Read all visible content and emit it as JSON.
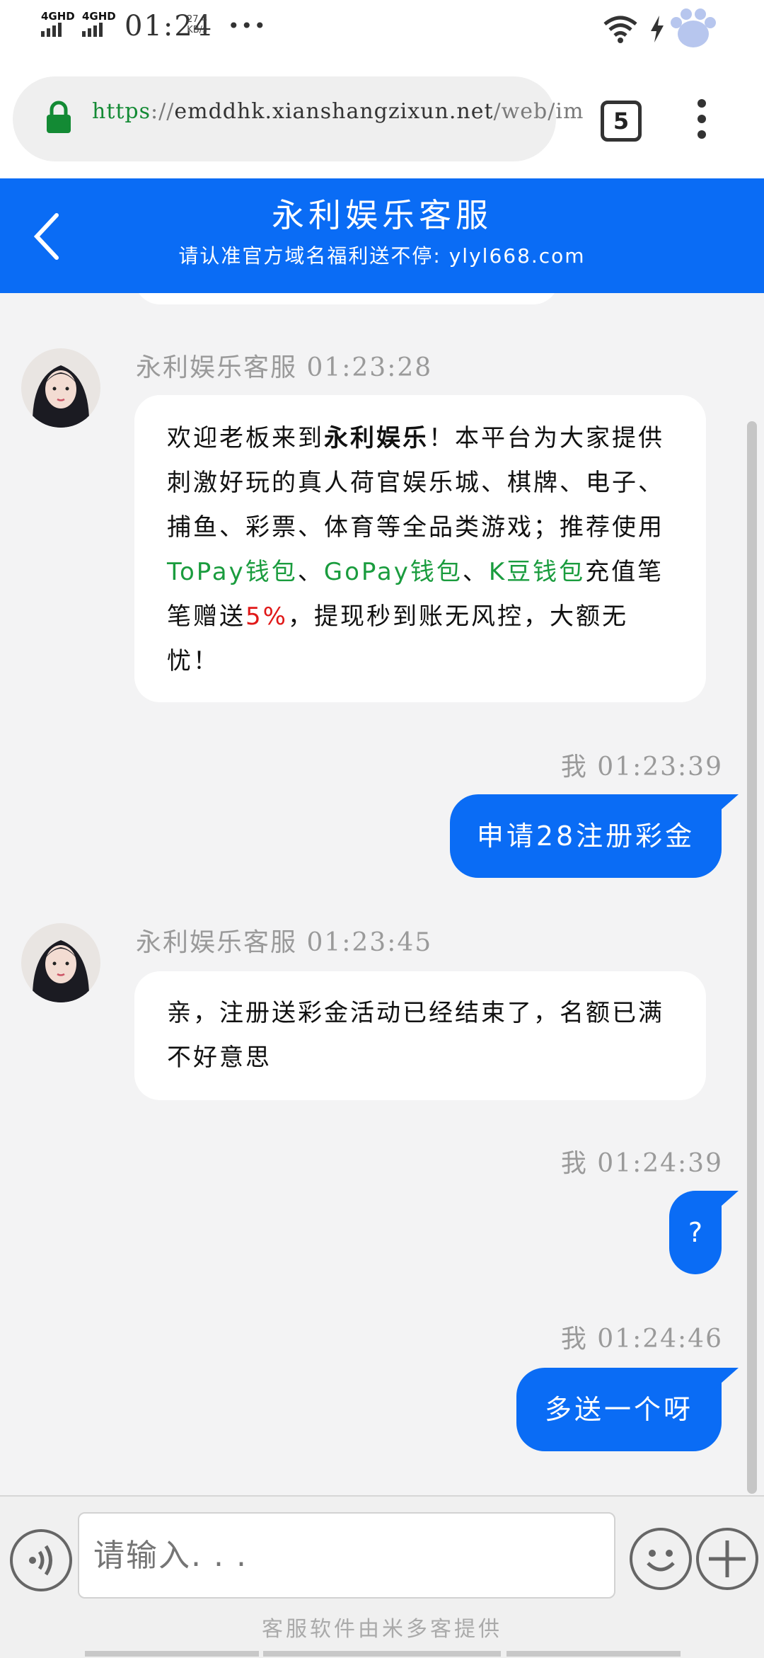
{
  "status_bar": {
    "network_1": "4GHD",
    "network_2": "4GHD",
    "time": "01:24",
    "speed_value": "27.4",
    "speed_unit": "KB/s",
    "more": "•••"
  },
  "browser": {
    "url_scheme": "https",
    "url_sep": "://",
    "url_host": "emddhk.xianshangzixun.net",
    "url_path": "/web/im",
    "tab_count": "5"
  },
  "header": {
    "title": "永利娱乐客服",
    "subtitle": "请认准官方域名福利送不停: ylyl668.com"
  },
  "messages": [
    {
      "sender": "永利娱乐客服",
      "time": "01:23:28",
      "meta": "永利娱乐客服 01:23:28",
      "parts": {
        "p1": "欢迎老板来到",
        "p2": "永利娱乐",
        "p3": "！本平台为大家提供刺激好玩的真人荷官娱乐城、棋牌、电子、捕鱼、彩票、体育等全品类游戏；推荐使用 ",
        "p4": "ToPay钱包",
        "p5": "、",
        "p6": "GoPay钱包",
        "p7": "、",
        "p8": "K豆钱包",
        "p9": "充值笔笔赠送",
        "p10": "5%",
        "p11": "，提现秒到账无风控，大额无忧！"
      }
    },
    {
      "sender": "我",
      "time": "01:23:39",
      "meta": "我 01:23:39",
      "text": "申请28注册彩金"
    },
    {
      "sender": "永利娱乐客服",
      "time": "01:23:45",
      "meta": "永利娱乐客服 01:23:45",
      "text": "亲，注册送彩金活动已经结束了，名额已满不好意思"
    },
    {
      "sender": "我",
      "time": "01:24:39",
      "meta": "我 01:24:39",
      "text": "?"
    },
    {
      "sender": "我",
      "time": "01:24:46",
      "meta": "我 01:24:46",
      "text": "多送一个呀"
    }
  ],
  "input": {
    "placeholder": "请输入. . ."
  },
  "footer": "客服软件由米多客提供",
  "colors": {
    "accent": "#0a6cf5",
    "green_link": "#1a9c3e",
    "red_highlight": "#e01818"
  },
  "icons": [
    "lock-icon",
    "back-icon",
    "voice-icon",
    "emoji-icon",
    "plus-icon",
    "wifi-icon",
    "charging-icon",
    "more-vert-icon"
  ]
}
